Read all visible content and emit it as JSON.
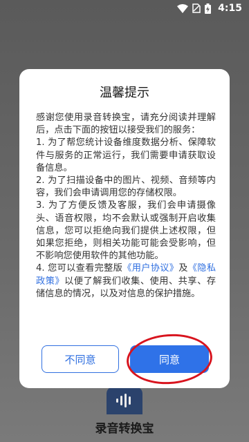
{
  "status_bar": {
    "time": "4:15"
  },
  "app": {
    "name": "录音转换宝"
  },
  "dialog": {
    "title": "温馨提示",
    "intro": "感谢您使用录音转换宝，请充分阅读并理解后，点击下面的按钮以接受我们的服务：",
    "item1": "1. 为了帮您统计设备维度数据分析、保障软件与服务的正常运行，我们需要申请获取设备信息。",
    "item2": "2. 为了扫描设备中的图片、视频、音频等内容，我们会申请调用您的存储权限。",
    "item3": "3. 为了方便反馈及客服，我们会申请摄像头、语音权限，均不会默认或强制开启收集信息，您可以拒绝向我们提供上述权限，但如果您拒绝，则相关功能可能会受影响，但不影响您使用软件的其他功能。",
    "item4_prefix": "4. 您可以查看完整版",
    "user_agreement": "《用户协议》",
    "and": "及",
    "privacy_policy": "《隐私政策》",
    "item4_suffix": "以便了解我们收集、使用、共享、存储信息的情况，以及对信息的保护措施。",
    "disagree_label": "不同意",
    "agree_label": "同意"
  },
  "colors": {
    "accent": "#2f72e8",
    "link": "#2f6fe0",
    "annotation_ring": "#d8141e"
  }
}
